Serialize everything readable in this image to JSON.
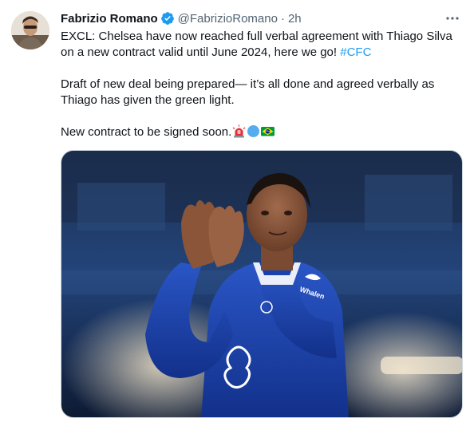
{
  "author": {
    "display_name": "Fabrizio Romano",
    "handle": "@FabrizioRomano",
    "separator": "·",
    "time": "2h",
    "verified_icon": "verified-badge-icon",
    "avatar_icon": "avatar-photo"
  },
  "more_icon": "more-options-icon",
  "tweet": {
    "line1_text": "EXCL: Chelsea have now reached full verbal agreement with Thiago Silva on a new contract valid until June 2024, here we go! ",
    "hashtag": "#CFC",
    "paragraph2": "Draft of new deal being prepared— it’s all done and agreed verbally as Thiago has given the green light.",
    "paragraph3": "New contract to be signed soon.",
    "emojis": [
      "siren-emoji-icon",
      "blue-circle-emoji-icon",
      "brazil-flag-emoji-icon"
    ]
  },
  "media": {
    "jersey_text": "Whale",
    "jersey_text_2": "n"
  },
  "colors": {
    "accent": "#1d9bf0",
    "secondary_text": "#536471",
    "chelsea_blue": "#1a3fae"
  }
}
